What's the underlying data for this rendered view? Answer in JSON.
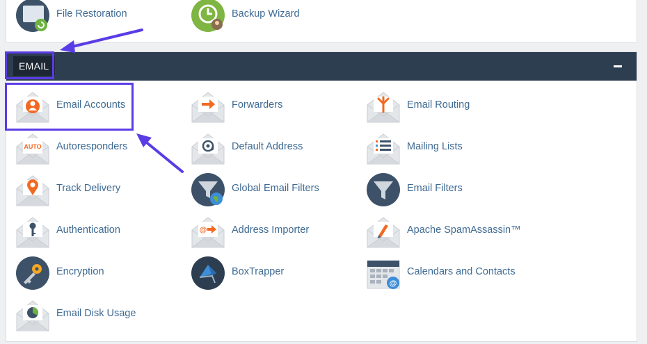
{
  "files_section": {
    "items": [
      {
        "label": "File Restoration",
        "icon": "folder-restore-icon"
      },
      {
        "label": "Backup Wizard",
        "icon": "backup-wizard-icon"
      }
    ]
  },
  "email_section": {
    "title": "EMAIL",
    "items": [
      {
        "label": "Email Accounts",
        "icon": "email-account-icon"
      },
      {
        "label": "Forwarders",
        "icon": "forward-arrow-icon"
      },
      {
        "label": "Email Routing",
        "icon": "routing-icon"
      },
      {
        "label": "Autoresponders",
        "icon": "auto-icon",
        "icon_text": "AUTO"
      },
      {
        "label": "Default Address",
        "icon": "at-sign-icon"
      },
      {
        "label": "Mailing Lists",
        "icon": "list-icon"
      },
      {
        "label": "Track Delivery",
        "icon": "location-pin-icon"
      },
      {
        "label": "Global Email Filters",
        "icon": "global-filter-icon"
      },
      {
        "label": "Email Filters",
        "icon": "filter-icon"
      },
      {
        "label": "Authentication",
        "icon": "key-icon"
      },
      {
        "label": "Address Importer",
        "icon": "import-icon"
      },
      {
        "label": "Apache SpamAssassin™",
        "icon": "spamassassin-icon"
      },
      {
        "label": "Encryption",
        "icon": "encryption-key-icon"
      },
      {
        "label": "BoxTrapper",
        "icon": "boxtrapper-icon"
      },
      {
        "label": "Calendars and Contacts",
        "icon": "calendar-icon"
      },
      {
        "label": "Email Disk Usage",
        "icon": "disk-usage-icon"
      }
    ]
  },
  "colors": {
    "header_bg": "#2d3e50",
    "link": "#3e6a93",
    "annotation": "#5a3ce6",
    "accent_orange": "#f26922"
  }
}
